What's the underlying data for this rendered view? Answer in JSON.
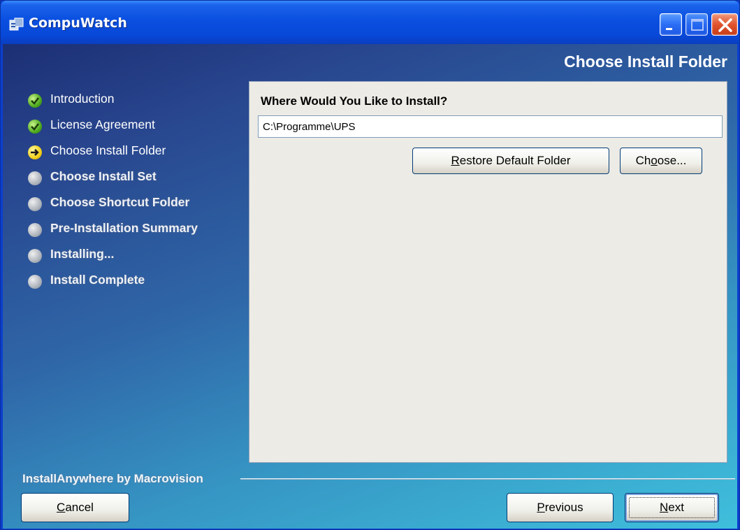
{
  "window": {
    "title": "CompuWatch",
    "title_icon": "installer-app-icon",
    "controls": [
      "minimize-icon",
      "maximize-icon",
      "close-icon"
    ]
  },
  "header": {
    "title": "Choose Install Folder"
  },
  "steps": [
    {
      "label": "Introduction",
      "state": "done",
      "icon": "check-icon"
    },
    {
      "label": "License Agreement",
      "state": "done",
      "icon": "check-icon"
    },
    {
      "label": "Choose Install Folder",
      "state": "current",
      "icon": "arrow-right-icon"
    },
    {
      "label": "Choose Install Set",
      "state": "pending",
      "icon": "pending-dot-icon"
    },
    {
      "label": "Choose Shortcut Folder",
      "state": "pending",
      "icon": "pending-dot-icon"
    },
    {
      "label": "Pre-Installation Summary",
      "state": "pending",
      "icon": "pending-dot-icon"
    },
    {
      "label": "Installing...",
      "state": "pending",
      "icon": "pending-dot-icon"
    },
    {
      "label": "Install Complete",
      "state": "pending",
      "icon": "pending-dot-icon"
    }
  ],
  "panel": {
    "heading": "Where Would You Like to Install?",
    "path_value": "C:\\Programme\\UPS",
    "restore_button": {
      "pre": "",
      "mnemonic": "R",
      "post": "estore Default Folder"
    },
    "choose_button": {
      "pre": "Ch",
      "mnemonic": "o",
      "post": "ose..."
    }
  },
  "footer": {
    "brand": "InstallAnywhere by Macrovision",
    "cancel_button": {
      "pre": "",
      "mnemonic": "C",
      "post": "ancel"
    },
    "previous_button": {
      "pre": "",
      "mnemonic": "P",
      "post": "revious"
    },
    "next_button": {
      "pre": "",
      "mnemonic": "N",
      "post": "ext"
    }
  },
  "colors": {
    "titlebar": "#0a4fe0",
    "panel_bg": "#ecebe6",
    "done_step": "#4faa1e",
    "current_step": "#f2d21a",
    "pending_step": "#aeb4bc"
  }
}
